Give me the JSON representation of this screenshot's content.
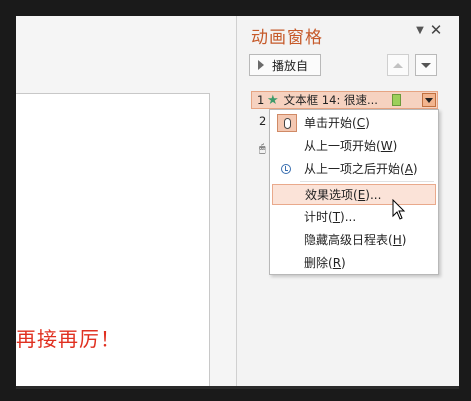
{
  "slide": {
    "text": "再接再厉！"
  },
  "pane": {
    "title": "动画窗格",
    "dropdown_icon": "chevron-down-icon",
    "close_icon": "close-icon",
    "play_button_label": "播放自",
    "items": [
      {
        "index": "1",
        "name": "文本框 14: 很速...",
        "icon": "star-icon"
      },
      {
        "index": "2"
      }
    ]
  },
  "context_menu": {
    "items": [
      {
        "label": "单击开始",
        "key": "C",
        "icon": "mouse-icon"
      },
      {
        "label": "从上一项开始",
        "key": "W"
      },
      {
        "label": "从上一项之后开始",
        "key": "A",
        "icon": "clock-icon"
      },
      {
        "label": "效果选项",
        "key": "E",
        "suffix": "..."
      },
      {
        "label": "计时",
        "key": "T",
        "suffix": "..."
      },
      {
        "label": "隐藏高级日程表",
        "key": "H"
      },
      {
        "label": "删除",
        "key": "R"
      }
    ]
  },
  "colors": {
    "title": "#c65a2a",
    "slide_text": "#e03020",
    "highlight": "#fbe3d8"
  }
}
